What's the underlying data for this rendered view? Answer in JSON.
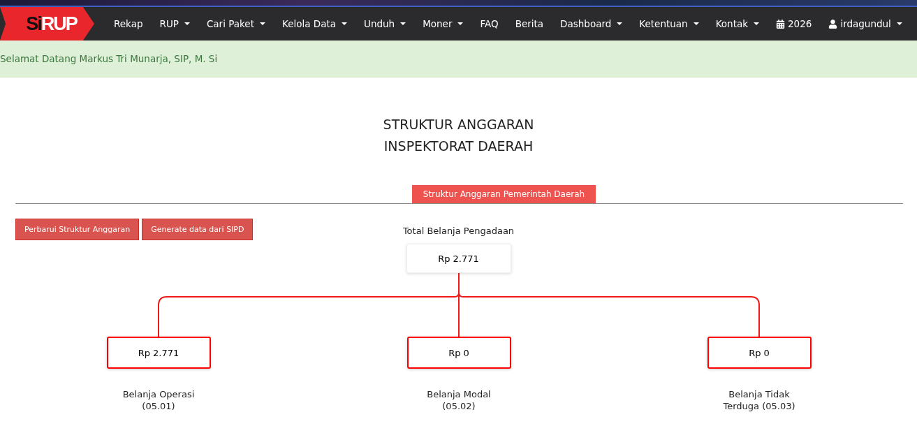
{
  "logo": {
    "prefix": "Si",
    "main": "RUP"
  },
  "nav": [
    {
      "label": "Rekap",
      "dropdown": false,
      "kind": "link"
    },
    {
      "label": "RUP",
      "dropdown": true,
      "kind": "link"
    },
    {
      "label": "Cari Paket",
      "dropdown": true,
      "kind": "link"
    },
    {
      "label": "Kelola Data",
      "dropdown": true,
      "kind": "link"
    },
    {
      "label": "Unduh",
      "dropdown": true,
      "kind": "link"
    },
    {
      "label": "Moner",
      "dropdown": true,
      "kind": "link"
    },
    {
      "label": "FAQ",
      "dropdown": false,
      "kind": "link"
    },
    {
      "label": "Berita",
      "dropdown": false,
      "kind": "link"
    },
    {
      "label": "Dashboard",
      "dropdown": true,
      "kind": "link"
    },
    {
      "label": "Ketentuan",
      "dropdown": true,
      "kind": "link"
    },
    {
      "label": "Kontak",
      "dropdown": true,
      "kind": "link"
    },
    {
      "label": "2026",
      "dropdown": false,
      "kind": "year"
    },
    {
      "label": "irdagundul",
      "dropdown": true,
      "kind": "account"
    }
  ],
  "alert": "Selamat Datang Markus Tri Munarja, SIP, M. Si",
  "title": [
    "STRUKTUR ANGGARAN",
    "INSPEKTORAT DAERAH"
  ],
  "tabs": [
    {
      "label": "Struktur Anggaran Pemerintah Daerah",
      "selected": true
    }
  ],
  "buttons": [
    "Perbarui Struktur Anggaran",
    "Generate data dari SIPD"
  ],
  "tree": {
    "label": "Total Belanja Pengadaan",
    "value": "Rp 2.771",
    "children": [
      {
        "value": "Rp 2.771",
        "label": [
          "Belanja Operasi",
          "(05.01)"
        ]
      },
      {
        "value": "Rp 0",
        "label": [
          "Belanja Modal",
          "(05.02)"
        ]
      },
      {
        "value": "Rp 0",
        "label": [
          "Belanja Tidak",
          "Terduga (05.03)"
        ]
      }
    ]
  }
}
